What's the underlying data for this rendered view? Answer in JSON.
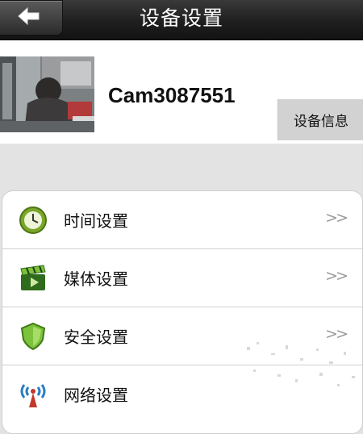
{
  "header": {
    "title": "设备设置",
    "back_icon": "back-arrow-icon"
  },
  "device": {
    "name": "Cam3087551",
    "info_button": "设备信息",
    "thumbnail_icon": "camera-feed-thumbnail"
  },
  "settings": {
    "items": [
      {
        "label": "时间设置",
        "icon": "clock-icon",
        "chevron": ">>"
      },
      {
        "label": "媒体设置",
        "icon": "clapperboard-icon",
        "chevron": ">>"
      },
      {
        "label": "安全设置",
        "icon": "shield-icon",
        "chevron": ">>"
      },
      {
        "label": "网络设置",
        "icon": "wifi-antenna-icon",
        "chevron": ""
      }
    ]
  },
  "colors": {
    "header_bg": "#1f1f1f",
    "page_bg": "#e3e3e3",
    "info_button_bg": "#d2d2d2",
    "chevron": "#9a9a9a"
  }
}
